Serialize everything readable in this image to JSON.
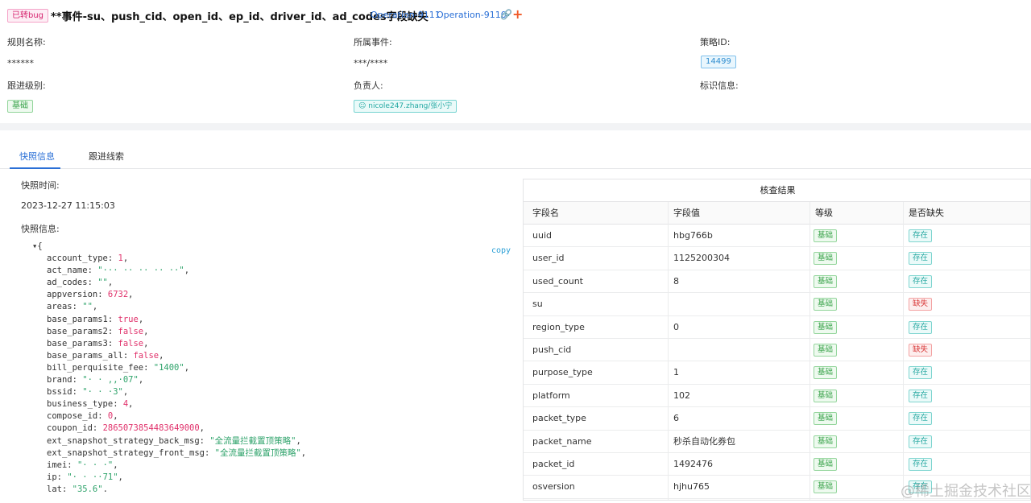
{
  "header": {
    "bug_badge": "已转bug",
    "title": "**事件-su、push_cid、open_id、ep_id、driver_id、ad_codes字段缺失",
    "op_links": [
      "Operation-9111",
      "Operation-9110"
    ],
    "link_icon": "link-icon",
    "plus_icon": "plus-icon"
  },
  "info": {
    "rule_name_label": "规则名称:",
    "rule_name_value": "******",
    "event_label": "所属事件:",
    "event_value": "***/****",
    "strategy_label": "策略ID:",
    "strategy_value": "14499",
    "level_label": "跟进级别:",
    "level_value": "基础",
    "owner_label": "负责人:",
    "owner_value": "nicole247.zhang/张小宁",
    "mark_label": "标识信息:"
  },
  "tabs": [
    "快照信息",
    "跟进线索"
  ],
  "snapshot": {
    "time_label": "快照时间:",
    "time_value": "2023-12-27 11:15:03",
    "info_label": "快照信息:",
    "copy": "copy",
    "json_open": "▾{",
    "json_lines": [
      {
        "k": "account_type",
        "v": "1",
        "t": "num"
      },
      {
        "k": "act_name",
        "v": "\"··· ·· ·· ·· ··\"",
        "t": "str"
      },
      {
        "k": "ad_codes",
        "v": "\"\"",
        "t": "str"
      },
      {
        "k": "appversion",
        "v": "6732",
        "t": "num"
      },
      {
        "k": "areas",
        "v": "\"\"",
        "t": "str"
      },
      {
        "k": "base_params1",
        "v": "true",
        "t": "bool"
      },
      {
        "k": "base_params2",
        "v": "false",
        "t": "bool"
      },
      {
        "k": "base_params3",
        "v": "false",
        "t": "bool"
      },
      {
        "k": "base_params_all",
        "v": "false",
        "t": "bool"
      },
      {
        "k": "bill_perquisite_fee",
        "v": "\"1400\"",
        "t": "str"
      },
      {
        "k": "brand",
        "v": "\"·  · ,,·07\"",
        "t": "str"
      },
      {
        "k": "bssid",
        "v": "\"·  ·  ·3\"",
        "t": "str"
      },
      {
        "k": "business_type",
        "v": "4",
        "t": "num"
      },
      {
        "k": "compose_id",
        "v": "0",
        "t": "num"
      },
      {
        "k": "coupon_id",
        "v": "2865073854483649000",
        "t": "num"
      },
      {
        "k": "ext_snapshot_strategy_back_msg",
        "v": "\"全流量拦截置顶策略\"",
        "t": "str"
      },
      {
        "k": "ext_snapshot_strategy_front_msg",
        "v": "\"全流量拦截置顶策略\"",
        "t": "str"
      },
      {
        "k": "imei",
        "v": "\"·  ·  ·\"",
        "t": "str"
      },
      {
        "k": "ip",
        "v": "\"·  ·  ··71\"",
        "t": "str"
      },
      {
        "k": "lat",
        "v": "\"35.6\"",
        "t": "str"
      }
    ]
  },
  "result": {
    "title": "核查结果",
    "headers": [
      "字段名",
      "字段值",
      "等级",
      "是否缺失"
    ],
    "rows": [
      {
        "name": "uuid",
        "value": "hbg766b",
        "level": "基础",
        "status": "存在",
        "missing": false
      },
      {
        "name": "user_id",
        "value": "1125200304",
        "level": "基础",
        "status": "存在",
        "missing": false
      },
      {
        "name": "used_count",
        "value": "8",
        "level": "基础",
        "status": "存在",
        "missing": false
      },
      {
        "name": "su",
        "value": "",
        "level": "基础",
        "status": "缺失",
        "missing": true
      },
      {
        "name": "region_type",
        "value": "0",
        "level": "基础",
        "status": "存在",
        "missing": false
      },
      {
        "name": "push_cid",
        "value": "",
        "level": "基础",
        "status": "缺失",
        "missing": true
      },
      {
        "name": "purpose_type",
        "value": "1",
        "level": "基础",
        "status": "存在",
        "missing": false
      },
      {
        "name": "platform",
        "value": "102",
        "level": "基础",
        "status": "存在",
        "missing": false
      },
      {
        "name": "packet_type",
        "value": "6",
        "level": "基础",
        "status": "存在",
        "missing": false
      },
      {
        "name": "packet_name",
        "value": "秒杀自动化券包",
        "level": "基础",
        "status": "存在",
        "missing": false
      },
      {
        "name": "packet_id",
        "value": "1492476",
        "level": "基础",
        "status": "存在",
        "missing": false
      },
      {
        "name": "osversion",
        "value": "hjhu765",
        "level": "基础",
        "status": "存在",
        "missing": false
      }
    ]
  },
  "watermark": "@稀土掘金技术社区"
}
